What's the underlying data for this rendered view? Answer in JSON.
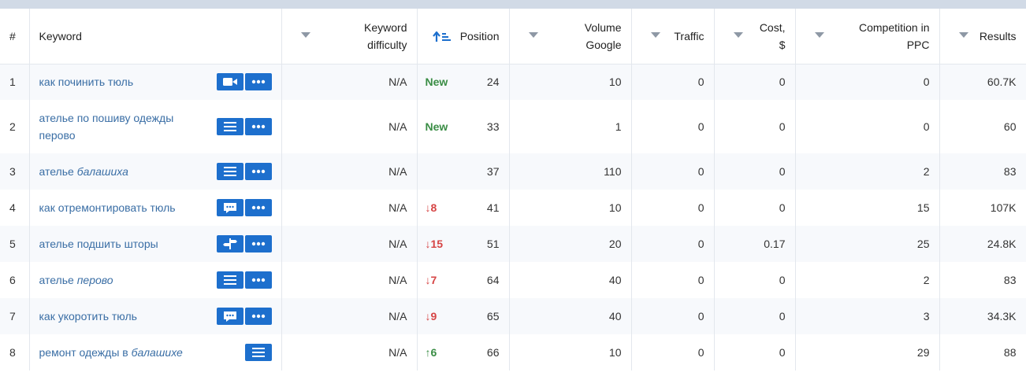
{
  "headers": {
    "num": "#",
    "keyword": "Keyword",
    "kd_line1": "Keyword",
    "kd_line2": "difficulty",
    "position": "Position",
    "volume_line1": "Volume",
    "volume_line2": "Google",
    "traffic": "Traffic",
    "cost_line1": "Cost,",
    "cost_line2": "$",
    "comp_line1": "Competition in",
    "comp_line2": "PPC",
    "results": "Results"
  },
  "colors": {
    "accent": "#1d6fcd",
    "link": "#3a6ea5",
    "new": "#3a8d45",
    "down": "#d64545",
    "up": "#3a8d45"
  },
  "rows": [
    {
      "num": "1",
      "kw_plain": "как починить тюль",
      "kw_italic": "",
      "icons": [
        "video-icon",
        "more-icon"
      ],
      "kd": "N/A",
      "change": "New",
      "change_type": "new",
      "position": "24",
      "volume": "10",
      "traffic": "0",
      "cost": "0",
      "competition": "0",
      "results": "60.7K"
    },
    {
      "num": "2",
      "kw_plain": "ателье по пошиву одежды перово",
      "kw_italic": "",
      "icons": [
        "list-icon",
        "more-icon"
      ],
      "kd": "N/A",
      "change": "New",
      "change_type": "new",
      "position": "33",
      "volume": "1",
      "traffic": "0",
      "cost": "0",
      "competition": "0",
      "results": "60"
    },
    {
      "num": "3",
      "kw_plain": "ателье ",
      "kw_italic": "балашиха",
      "icons": [
        "list-icon",
        "more-icon"
      ],
      "kd": "N/A",
      "change": "",
      "change_type": "none",
      "position": "37",
      "volume": "110",
      "traffic": "0",
      "cost": "0",
      "competition": "2",
      "results": "83"
    },
    {
      "num": "4",
      "kw_plain": "как отремонтировать тюль",
      "kw_italic": "",
      "icons": [
        "comment-icon",
        "more-icon"
      ],
      "kd": "N/A",
      "change": "↓8",
      "change_type": "down",
      "position": "41",
      "volume": "10",
      "traffic": "0",
      "cost": "0",
      "competition": "15",
      "results": "107K"
    },
    {
      "num": "5",
      "kw_plain": "ателье подшить шторы",
      "kw_italic": "",
      "icons": [
        "signpost-icon",
        "more-icon"
      ],
      "kd": "N/A",
      "change": "↓15",
      "change_type": "down",
      "position": "51",
      "volume": "20",
      "traffic": "0",
      "cost": "0.17",
      "competition": "25",
      "results": "24.8K"
    },
    {
      "num": "6",
      "kw_plain": "ателье ",
      "kw_italic": "перово",
      "icons": [
        "list-icon",
        "more-icon"
      ],
      "kd": "N/A",
      "change": "↓7",
      "change_type": "down",
      "position": "64",
      "volume": "40",
      "traffic": "0",
      "cost": "0",
      "competition": "2",
      "results": "83"
    },
    {
      "num": "7",
      "kw_plain": "как укоротить тюль",
      "kw_italic": "",
      "icons": [
        "comment-icon",
        "more-icon"
      ],
      "kd": "N/A",
      "change": "↓9",
      "change_type": "down",
      "position": "65",
      "volume": "40",
      "traffic": "0",
      "cost": "0",
      "competition": "3",
      "results": "34.3K"
    },
    {
      "num": "8",
      "kw_plain": "ремонт одежды в ",
      "kw_italic": "балашихе",
      "icons": [
        "list-icon"
      ],
      "kd": "N/A",
      "change": "↑6",
      "change_type": "up",
      "position": "66",
      "volume": "10",
      "traffic": "0",
      "cost": "0",
      "competition": "29",
      "results": "88"
    }
  ]
}
